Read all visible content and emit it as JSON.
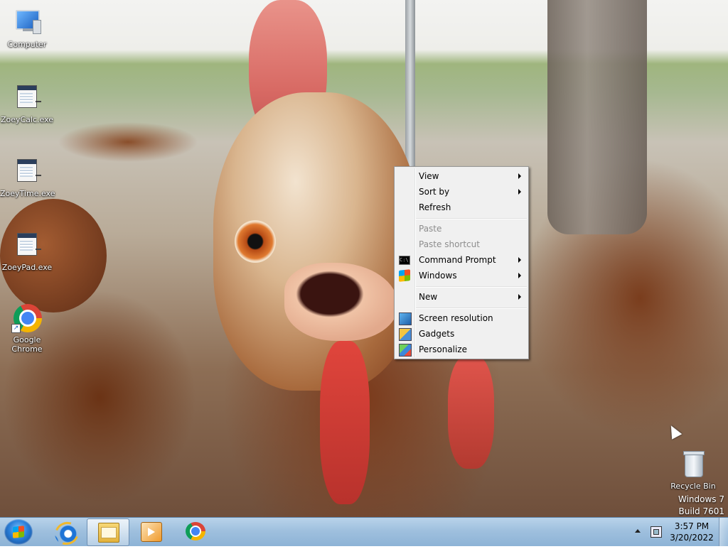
{
  "desktop": {
    "icons": [
      {
        "label": "Computer",
        "icon": "computer-icon"
      },
      {
        "label": "ZoeyCalc.exe",
        "icon": "exe-icon"
      },
      {
        "label": "ZoeyTime.exe",
        "icon": "exe-icon"
      },
      {
        "label": "ZoeyPad.exe",
        "icon": "exe-icon"
      },
      {
        "label": "Google Chrome",
        "icon": "chrome-icon"
      },
      {
        "label": "Recycle Bin",
        "icon": "recycle-bin-icon"
      }
    ],
    "watermark": {
      "line1": "Windows 7",
      "line2": "Build 7601"
    }
  },
  "context_menu": {
    "items": [
      {
        "label": "View",
        "submenu": true
      },
      {
        "label": "Sort by",
        "submenu": true
      },
      {
        "label": "Refresh"
      },
      {
        "label": "Paste",
        "disabled": true
      },
      {
        "label": "Paste shortcut",
        "disabled": true
      },
      {
        "label": "Command Prompt",
        "submenu": true,
        "icon": "command-prompt-icon"
      },
      {
        "label": "Windows",
        "submenu": true,
        "icon": "windows-logo-icon"
      },
      {
        "label": "New",
        "submenu": true
      },
      {
        "label": "Screen resolution",
        "icon": "screen-resolution-icon"
      },
      {
        "label": "Gadgets",
        "icon": "gadgets-icon"
      },
      {
        "label": "Personalize",
        "icon": "personalize-icon"
      }
    ]
  },
  "taskbar": {
    "pinned": [
      "internet-explorer-icon",
      "windows-explorer-icon",
      "windows-media-player-icon",
      "google-chrome-icon"
    ],
    "clock": {
      "time": "3:57 PM",
      "date": "3/20/2022"
    }
  },
  "colors": {
    "taskbar": "#9fc0de",
    "menu_bg": "#f0f0f0",
    "menu_disabled_text": "#8d8d8d"
  }
}
